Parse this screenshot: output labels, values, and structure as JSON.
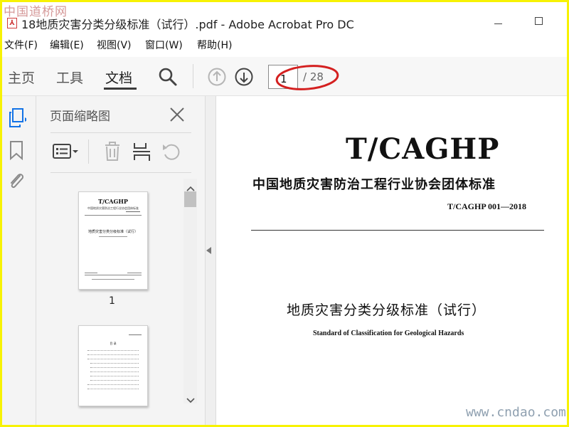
{
  "watermark": {
    "top_left": "中国道桥网",
    "bottom_right": "www.cndao.com"
  },
  "window": {
    "title": "18地质灾害分类分级标准（试行）.pdf - Adobe Acrobat Pro DC"
  },
  "menu": [
    {
      "label": "文件(F)"
    },
    {
      "label": "编辑(E)"
    },
    {
      "label": "视图(V)"
    },
    {
      "label": "窗口(W)"
    },
    {
      "label": "帮助(H)"
    }
  ],
  "toolbar": {
    "tabs": [
      {
        "label": "主页"
      },
      {
        "label": "工具"
      },
      {
        "label": "文档",
        "active": true
      }
    ],
    "icons": [
      "search-icon",
      "page-up-icon",
      "page-down-icon"
    ],
    "page_current": "1",
    "page_total": "/ 28",
    "highlight_color": "#d42020"
  },
  "leftrail": {
    "icons": [
      "pages-icon",
      "bookmark-icon",
      "attachment-icon"
    ],
    "active_color": "#1473e6"
  },
  "panel": {
    "title": "页面缩略图",
    "icons": [
      "thumbnail-options-icon",
      "delete-icon",
      "extract-icon",
      "rotate-icon"
    ],
    "thumbnails": [
      {
        "label": "1",
        "brand": "T/CAGHP",
        "assoc": "中国地质灾害防治工程行业协会团体标准",
        "title": "地质灾害分类分级标准（试行）"
      },
      {
        "label": "",
        "brand": "",
        "assoc": "",
        "title": "目 录"
      }
    ]
  },
  "document": {
    "brand": "T/CAGHP",
    "association": "中国地质灾害防治工程行业协会团体标准",
    "code": "T/CAGHP 001—2018",
    "title": "地质灾害分类分级标准（试行）",
    "subtitle": "Standard of Classification for Geological Hazards"
  },
  "colors": {
    "accent": "#1473e6",
    "frame": "#f7f205"
  }
}
